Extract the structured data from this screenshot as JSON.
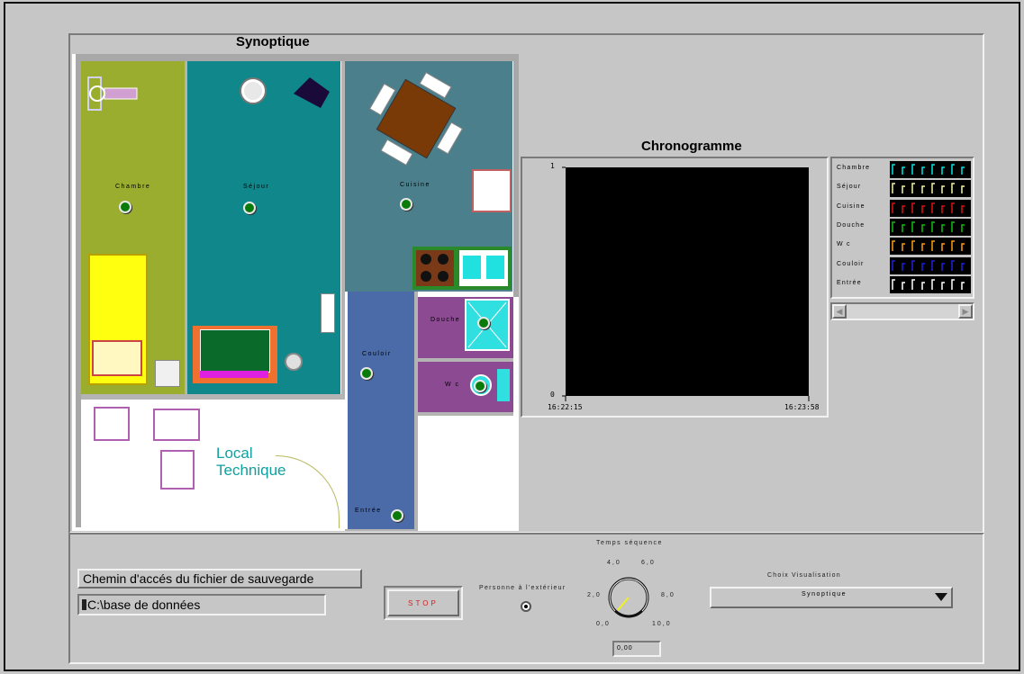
{
  "synoptique": {
    "title": "Synoptique",
    "rooms": {
      "chambre": "Chambre",
      "sejour": "Séjour",
      "cuisine": "Cuisine",
      "douche": "Douche",
      "wc": "W c",
      "couloir": "Couloir",
      "entree": "Entrée",
      "local_line1": "Local",
      "local_line2": "Technique"
    }
  },
  "chrono": {
    "title": "Chronogramme",
    "y_max": "1",
    "y_min": "0",
    "t_start": "16:22:15",
    "t_end": "16:23:58"
  },
  "chart_data": {
    "type": "line",
    "title": "Chronogramme",
    "x": [
      "16:22:15",
      "16:23:58"
    ],
    "ylim": [
      0,
      1
    ],
    "series": [
      {
        "name": "Chambre",
        "color": "#00e5e5"
      },
      {
        "name": "Séjour",
        "color": "#f5f5a0"
      },
      {
        "name": "Cuisine",
        "color": "#e01010"
      },
      {
        "name": "Douche",
        "color": "#10c010"
      },
      {
        "name": "W c",
        "color": "#ff9a10"
      },
      {
        "name": "Couloir",
        "color": "#2020e0"
      },
      {
        "name": "Entrée",
        "color": "#ffffff"
      }
    ]
  },
  "controls": {
    "path_label": "Chemin d'accés du fichier de sauvegarde",
    "path_value": "C:\\base de données",
    "stop_label": "STOP",
    "outside_label": "Personne à l'extérieur",
    "temps_label": "Temps séquence",
    "knob_ticks": {
      "t0": "0,0",
      "t2": "2,0",
      "t4": "4,0",
      "t6": "6,0",
      "t8": "8,0",
      "t10": "10,0"
    },
    "temps_value": "0,00",
    "knob_value": 0,
    "choix_label": "Choix Visualisation",
    "choix_value": "Synoptique"
  }
}
